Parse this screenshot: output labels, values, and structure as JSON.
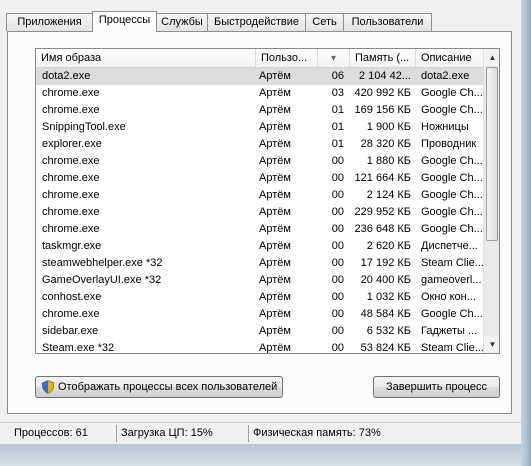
{
  "tabs": [
    {
      "label": "Приложения"
    },
    {
      "label": "Процессы"
    },
    {
      "label": "Службы"
    },
    {
      "label": "Быстродействие"
    },
    {
      "label": "Сеть"
    },
    {
      "label": "Пользователи"
    }
  ],
  "table": {
    "headers": [
      "Имя образа",
      "Пользо...",
      "",
      "Память (...",
      "Описание"
    ],
    "sort_indicator": "▾",
    "rows": [
      [
        "dota2.exe",
        "Артём",
        "06",
        "2 104 42...",
        "dota2.exe"
      ],
      [
        "chrome.exe",
        "Артём",
        "03",
        "420 992 КБ",
        "Google Ch..."
      ],
      [
        "chrome.exe",
        "Артём",
        "01",
        "169 156 КБ",
        "Google Ch..."
      ],
      [
        "SnippingTool.exe",
        "Артём",
        "01",
        "1 900 КБ",
        "Ножницы"
      ],
      [
        "explorer.exe",
        "Артём",
        "01",
        "28 320 КБ",
        "Проводник"
      ],
      [
        "chrome.exe",
        "Артём",
        "00",
        "1 880 КБ",
        "Google Ch..."
      ],
      [
        "chrome.exe",
        "Артём",
        "00",
        "121 664 КБ",
        "Google Ch..."
      ],
      [
        "chrome.exe",
        "Артём",
        "00",
        "2 124 КБ",
        "Google Ch..."
      ],
      [
        "chrome.exe",
        "Артём",
        "00",
        "229 952 КБ",
        "Google Ch..."
      ],
      [
        "chrome.exe",
        "Артём",
        "00",
        "236 648 КБ",
        "Google Ch..."
      ],
      [
        "taskmgr.exe",
        "Артём",
        "00",
        "2 620 КБ",
        "Диспетче..."
      ],
      [
        "steamwebhelper.exe *32",
        "Артём",
        "00",
        "17 192 КБ",
        "Steam Clie..."
      ],
      [
        "GameOverlayUI.exe *32",
        "Артём",
        "00",
        "20 400 КБ",
        "gameoverl..."
      ],
      [
        "conhost.exe",
        "Артём",
        "00",
        "1 032 КБ",
        "Окно кон..."
      ],
      [
        "chrome.exe",
        "Артём",
        "00",
        "48 584 КБ",
        "Google Ch..."
      ],
      [
        "sidebar.exe",
        "Артём",
        "00",
        "6 532 КБ",
        "Гаджеты ..."
      ],
      [
        "Steam.exe *32",
        "Артём",
        "00",
        "53 824 КБ",
        "Steam Clie..."
      ]
    ],
    "selected_row": 0
  },
  "buttons": {
    "show_all": "Отображать процессы всех пользователей",
    "end_process": "Завершить процесс"
  },
  "status": {
    "processes": "Процессов: 61",
    "cpu": "Загрузка ЦП: 15%",
    "memory": "Физическая память: 73%"
  },
  "icons": {
    "shield": "shield-icon",
    "scroll_up": "scroll-up-icon",
    "scroll_down": "scroll-down-icon",
    "sort": "sort-desc-icon"
  }
}
